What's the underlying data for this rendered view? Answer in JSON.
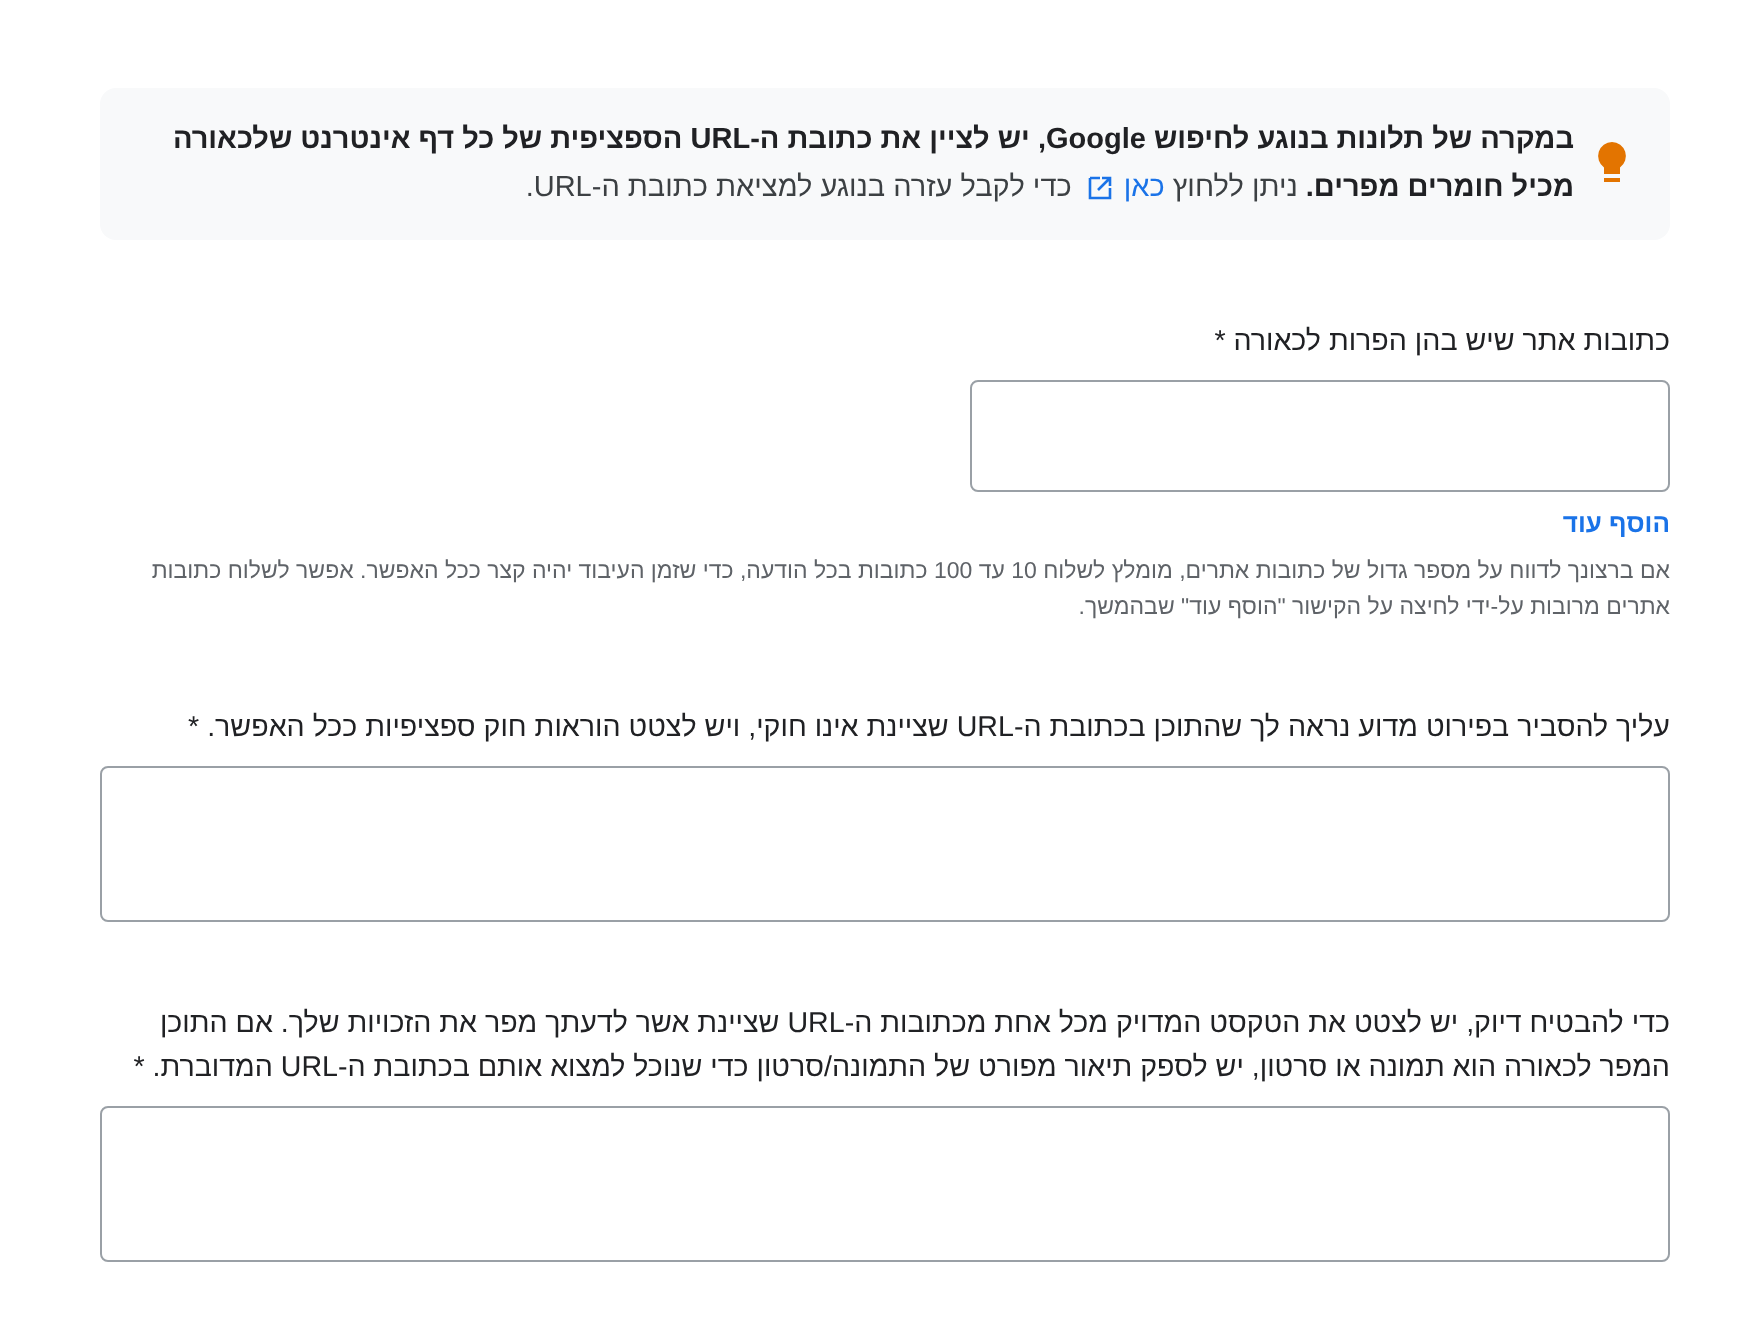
{
  "notice": {
    "text": "**במקרה של תלונות בנוגע לחיפוש Google, יש לציין את כתובת ה-URL הספציפית של כל דף אינטרנט שלכאורה מכיל חומרים מפרים.** ניתן ללחוץ",
    "link": "כאן",
    "text_after": "כדי לקבל עזרה בנוגע למציאת כתובת ה-URL."
  },
  "fields": [
    {
      "kind": "input",
      "label": "כתובות אתר שיש בהן הפרות לכאורה *",
      "add_more": "הוסף עוד",
      "help": "אם ברצונך לדווח על מספר גדול של כתובות אתרים, מומלץ לשלוח 10 עד 100 כתובות בכל הודעה, כדי שזמן העיבוד יהיה קצר ככל האפשר. אפשר לשלוח כתובות אתרים מרובות על-ידי לחיצה על הקישור \"הוסף עוד\" שבהמשך."
    },
    {
      "kind": "textarea",
      "label": "עליך להסביר בפירוט מדוע נראה לך שהתוכן בכתובת ה-URL שציינת אינו חוקי, ויש לצטט הוראות חוק ספציפיות ככל האפשר. *"
    },
    {
      "kind": "textarea",
      "label": "כדי להבטיח דיוק, יש לצטט את הטקסט המדויק מכל אחת מכתובות ה-URL שציינת אשר לדעתך מפר את הזכויות שלך. אם התוכן המפר לכאורה הוא תמונה או סרטון, יש לספק תיאור מפורט של התמונה/סרטון כדי שנוכל למצוא אותם בכתובת ה-URL המדוברת. *"
    }
  ]
}
